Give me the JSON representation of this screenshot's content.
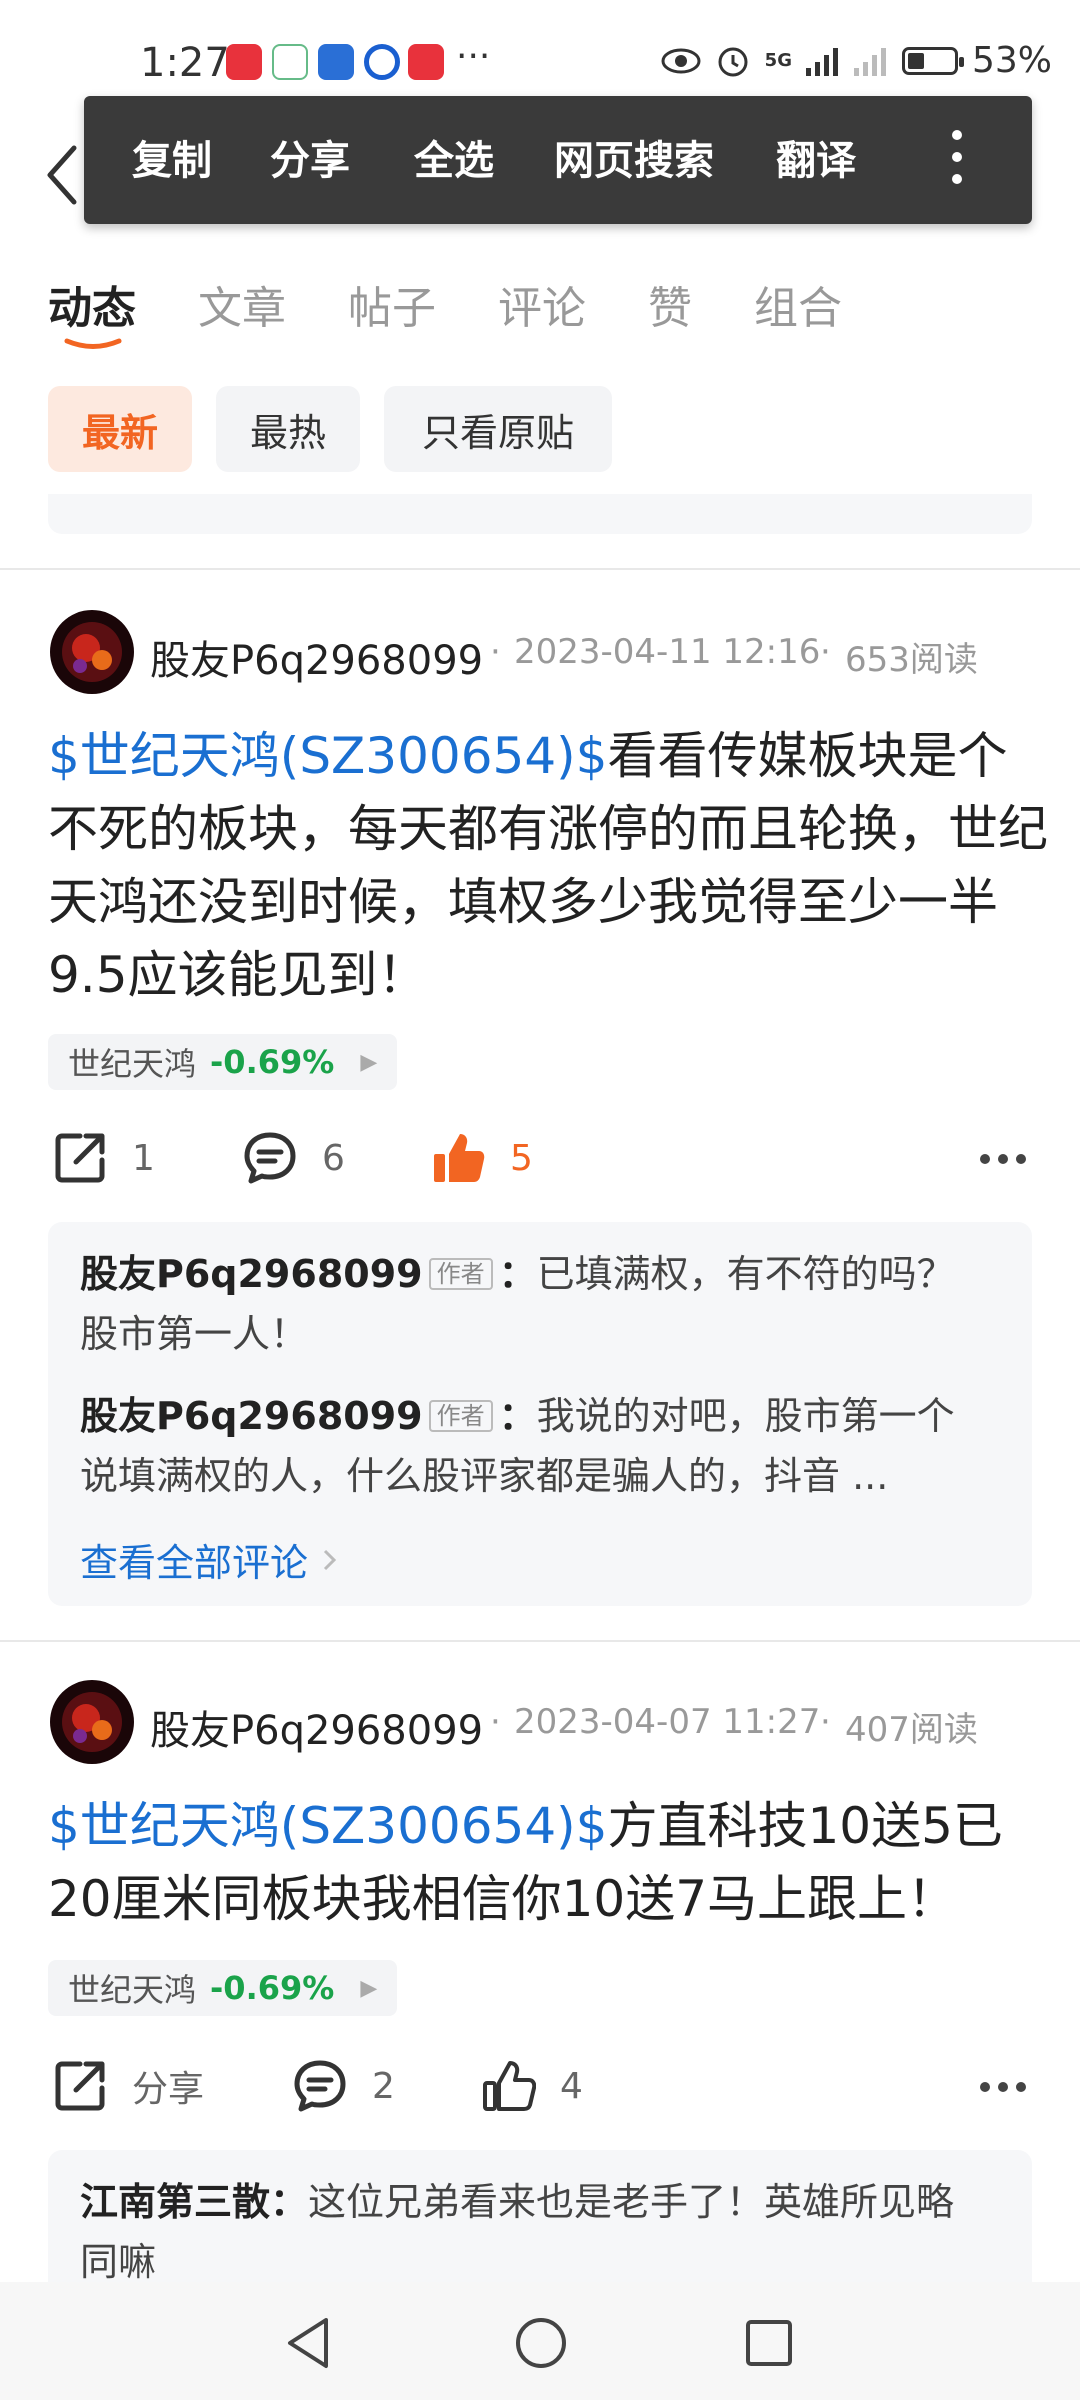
{
  "status_bar": {
    "time": "1:27",
    "more": "···",
    "signal": "5G",
    "battery": "53%"
  },
  "popup": {
    "items": [
      "复制",
      "分享",
      "全选",
      "网页搜索",
      "翻译"
    ]
  },
  "tabs": [
    "动态",
    "文章",
    "帖子",
    "评论",
    "赞",
    "组合"
  ],
  "filters": [
    "最新",
    "最热",
    "只看原贴"
  ],
  "posts": [
    {
      "user": "股友P6q2968099",
      "sep": "·",
      "date": "2023-04-11 12:16",
      "reads": "653阅读",
      "stock_tag": "$世纪天鸿(SZ300654)$",
      "text": "看看传媒板块是个不死的板块，每天都有涨停的而且轮换，世纪天鸿还没到时候，填权多少我觉得至少一半9.5应该能见到！",
      "stock_name": "世纪天鸿",
      "stock_change": "-0.69%",
      "share": "1",
      "comments": "6",
      "likes": "5",
      "replies": [
        {
          "user": "股友P6q2968099",
          "badge": "作者",
          "colon": "：",
          "text": "已填满权，有不符的吗？股市第一人！"
        },
        {
          "user": "股友P6q2968099",
          "badge": "作者",
          "colon": "：",
          "text": "我说的对吧，股市第一个说填满权的人，什么股评家都是骗人的，抖音 ..."
        }
      ],
      "view_all": "查看全部评论"
    },
    {
      "user": "股友P6q2968099",
      "sep": "·",
      "date": "2023-04-07 11:27",
      "reads": "407阅读",
      "stock_tag": "$世纪天鸿(SZ300654)$",
      "text": "方直科技10送5已20厘米同板块我相信你10送7马上跟上！",
      "stock_name": "世纪天鸿",
      "stock_change": "-0.69%",
      "share": "分享",
      "comments": "2",
      "likes": "4",
      "replies": [
        {
          "user": "江南第三散",
          "colon": "：",
          "text": "这位兄弟看来也是老手了！英雄所见略同嘛"
        }
      ]
    }
  ],
  "colors": {
    "accent": "#f26522",
    "link": "#1a6fd1",
    "down": "#1aa34a"
  }
}
